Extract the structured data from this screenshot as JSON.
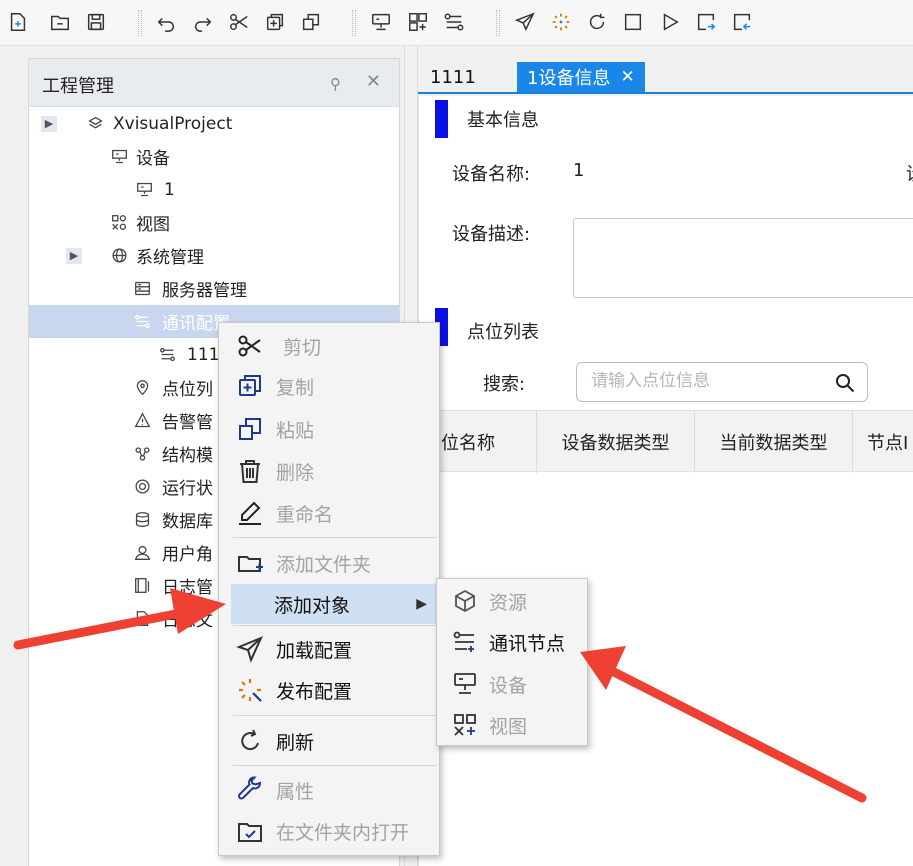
{
  "toolbar": {
    "icons": [
      "new-project-icon",
      "open-folder-icon",
      "save-icon",
      "undo-icon",
      "redo-icon",
      "cut-icon",
      "copy-icon",
      "paste-icon",
      "device-icon",
      "view-icon",
      "comm-node-icon",
      "load-config-icon",
      "publish-config-icon",
      "refresh-icon",
      "stop-icon",
      "run-icon",
      "export-icon",
      "import-icon"
    ]
  },
  "left_panel": {
    "title": "工程管理",
    "pin_glyph": "⚲",
    "close_glyph": "✕",
    "tree": [
      {
        "label": "XvisualProject",
        "icon": "layers-icon"
      },
      {
        "label": "设备",
        "icon": "device-icon"
      },
      {
        "label": "1",
        "icon": "device-icon"
      },
      {
        "label": "视图",
        "icon": "view-icon"
      },
      {
        "label": "系统管理",
        "icon": "globe-icon"
      },
      {
        "label": "服务器管理",
        "icon": "server-icon"
      },
      {
        "label": "通讯配置",
        "icon": "comm-config-icon"
      },
      {
        "label": "111",
        "icon": "comm-node-icon"
      },
      {
        "label": "点位列",
        "icon": "location-icon"
      },
      {
        "label": "告警管",
        "icon": "warning-icon"
      },
      {
        "label": "结构模",
        "icon": "structure-icon"
      },
      {
        "label": "运行状",
        "icon": "status-icon"
      },
      {
        "label": "数据库",
        "icon": "database-icon"
      },
      {
        "label": "用户角",
        "icon": "user-icon"
      },
      {
        "label": "日志管",
        "icon": "log-icon"
      },
      {
        "label": "日志文",
        "icon": "log-file-icon"
      }
    ]
  },
  "tabs": [
    {
      "label": "1111"
    },
    {
      "label": "1设备信息",
      "close": "✕"
    }
  ],
  "content": {
    "basic_info_title": "基本信息",
    "device_name_label": "设备名称:",
    "device_name_value": "1",
    "partial_label": "设",
    "device_desc_label": "设备描述:",
    "point_list_title": "点位列表",
    "search_label": "搜索:",
    "search_placeholder": "请输入点位信息",
    "columns": [
      "点位名称",
      "设备数据类型",
      "当前数据类型",
      "节点I"
    ]
  },
  "context_menu": {
    "items": [
      {
        "label": "剪切",
        "icon": "scissors-icon",
        "enabled": false
      },
      {
        "label": "复制",
        "icon": "copy-icon",
        "enabled": false
      },
      {
        "label": "粘贴",
        "icon": "paste-icon",
        "enabled": false
      },
      {
        "label": "删除",
        "icon": "trash-icon",
        "enabled": false
      },
      {
        "label": "重命名",
        "icon": "pencil-icon",
        "enabled": false
      },
      {
        "label": "添加文件夹",
        "icon": "add-folder-icon",
        "enabled": false
      },
      {
        "label": "添加对象",
        "enabled": true,
        "has_submenu": true
      },
      {
        "label": "加载配置",
        "icon": "send-icon",
        "enabled": true
      },
      {
        "label": "发布配置",
        "icon": "sparkle-icon",
        "enabled": true
      },
      {
        "label": "刷新",
        "icon": "refresh-icon",
        "enabled": true
      },
      {
        "label": "属性",
        "icon": "wrench-icon",
        "enabled": false
      },
      {
        "label": "在文件夹内打开",
        "icon": "open-in-folder-icon",
        "enabled": false
      }
    ]
  },
  "submenu": {
    "items": [
      {
        "label": "资源",
        "icon": "cube-icon",
        "enabled": false
      },
      {
        "label": "通讯节点",
        "icon": "comm-node-icon",
        "enabled": true
      },
      {
        "label": "设备",
        "icon": "device-icon",
        "enabled": false
      },
      {
        "label": "视图",
        "icon": "view-icon",
        "enabled": false
      }
    ]
  },
  "colors": {
    "accent": "#1a86e8",
    "section_bar": "#0a10e8",
    "selection": "#c9d6ef",
    "annotation_arrow": "#ee4133"
  }
}
